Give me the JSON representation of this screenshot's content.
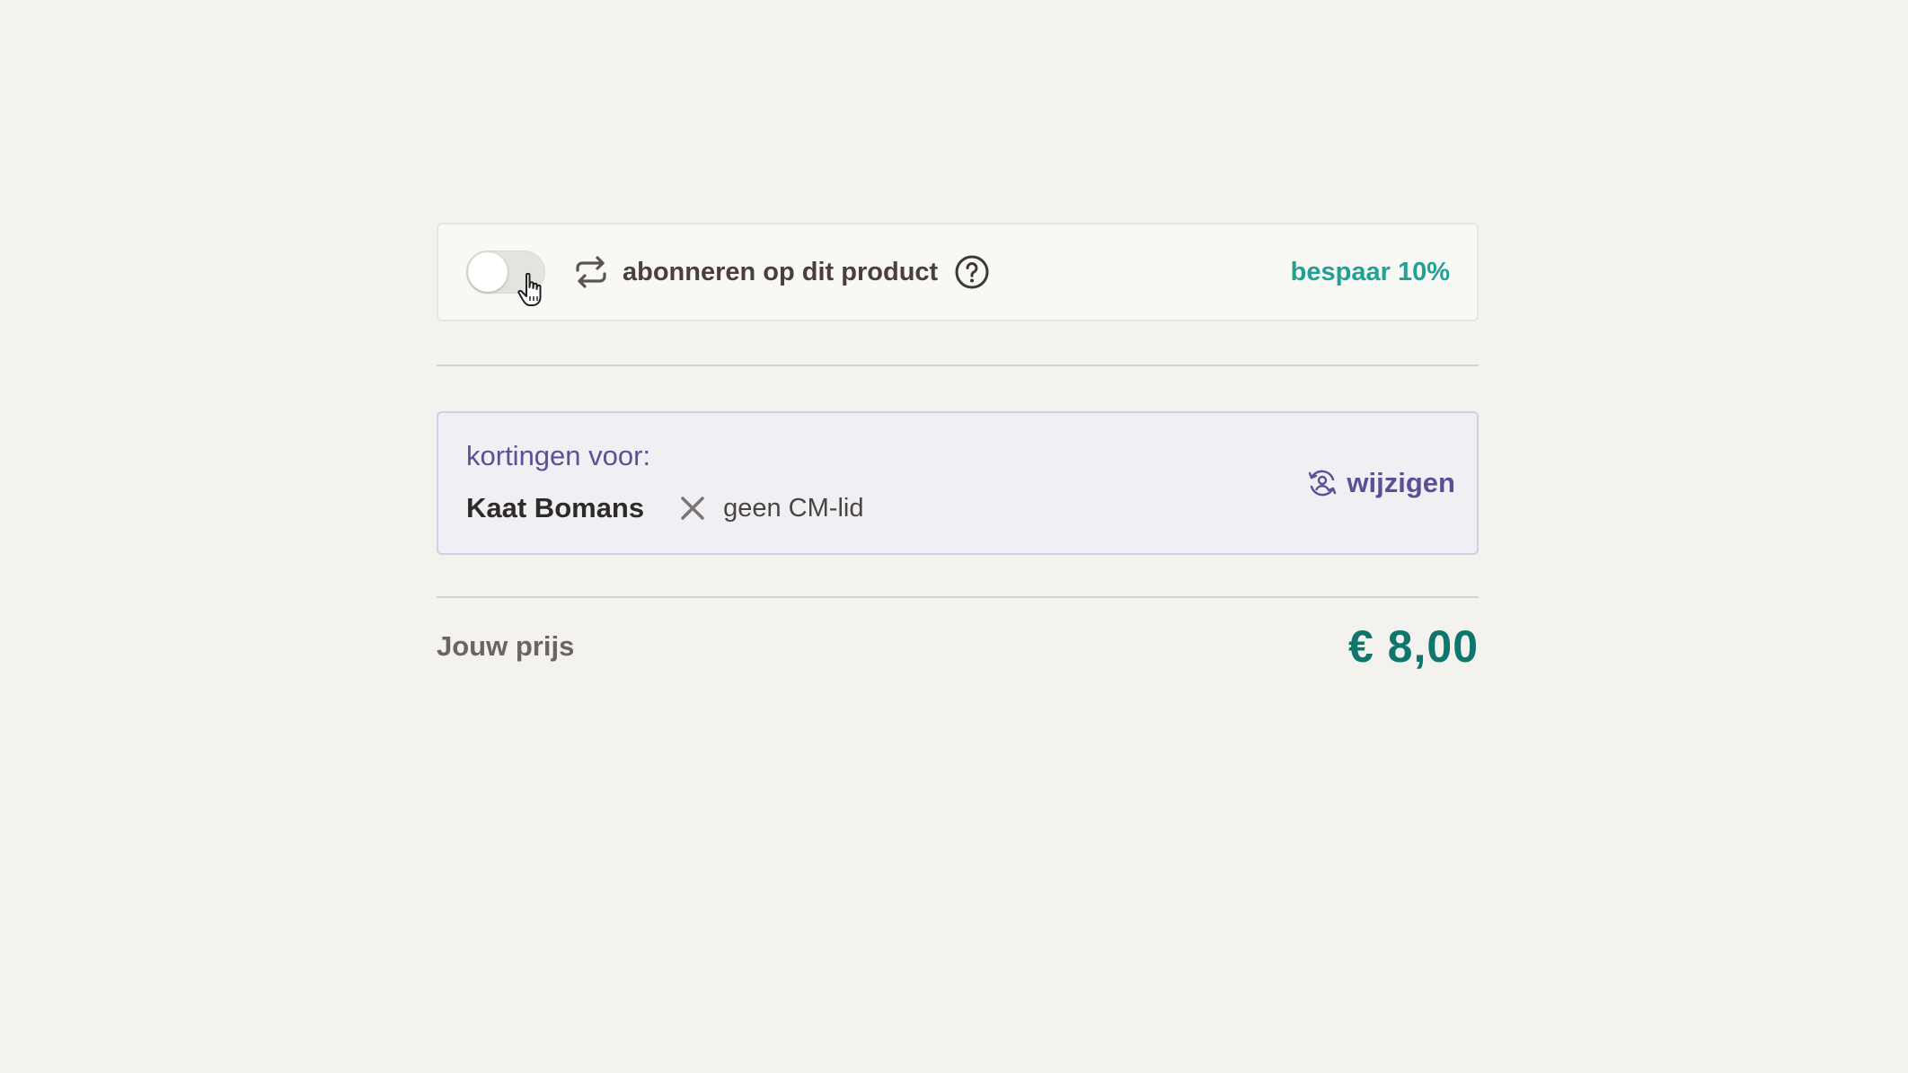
{
  "subscription": {
    "toggle_on": false,
    "label": "abonneren op dit product",
    "savings_badge": "bespaar 10%"
  },
  "discounts": {
    "title": "kortingen voor:",
    "person_name": "Kaat Bomans",
    "member_status": "geen CM-lid",
    "change_label": "wijzigen"
  },
  "price": {
    "label": "Jouw prijs",
    "value": "€ 8,00"
  },
  "colors": {
    "accent_teal": "#23a095",
    "price_teal": "#0e766c",
    "purple": "#5c4f94",
    "background": "#f3f2ee"
  },
  "icons": [
    "repeat-icon",
    "help-icon",
    "close-icon",
    "user-sync-icon",
    "hand-pointer-icon"
  ]
}
